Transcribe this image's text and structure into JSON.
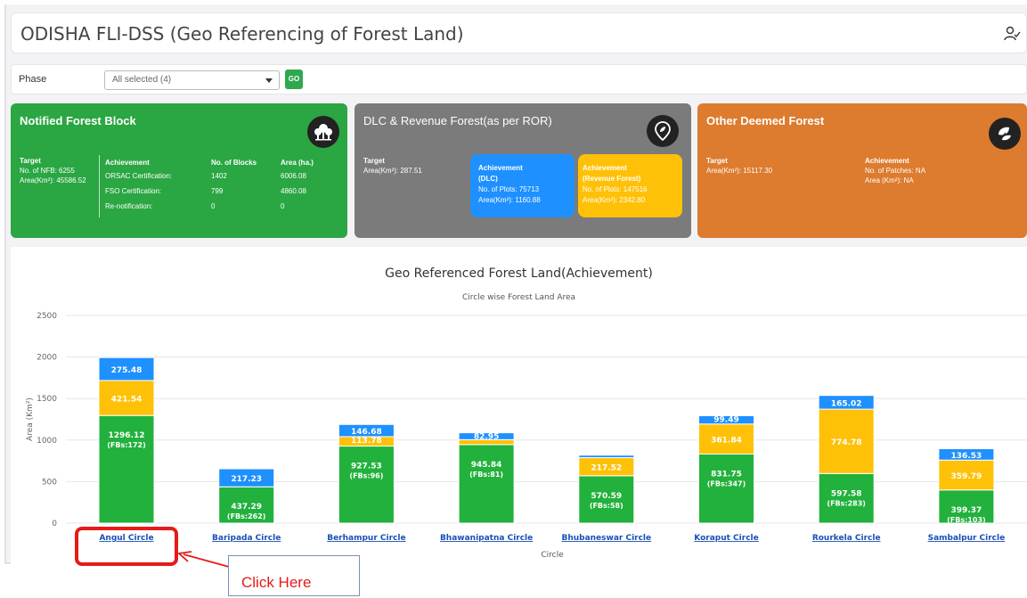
{
  "app": {
    "title": "ODISHA FLI-DSS (Geo Referencing of Forest Land)"
  },
  "filter": {
    "phase_label": "Phase",
    "phase_value": "All selected (4)",
    "go_label": "GO"
  },
  "cards": {
    "nfb": {
      "title": "Notified Forest Block",
      "target_heading": "Target",
      "target_line1": "No. of NFB: 6255",
      "target_line2": "Area(Km²): 45586.52",
      "achievement_heading": "Achievement",
      "blocks_heading": "No. of Blocks",
      "area_heading": "Area (ha.)",
      "rows": [
        {
          "label": "ORSAC Certification:",
          "blocks": "1402",
          "area": "6006.08"
        },
        {
          "label": "FSO Certification:",
          "blocks": "799",
          "area": "4860.08"
        },
        {
          "label": "Re-notification:",
          "blocks": "0",
          "area": "0"
        }
      ]
    },
    "dlc": {
      "title": "DLC & Revenue Forest(as per ROR)",
      "target_heading": "Target",
      "target_line": "Area(Km²): 287.51",
      "dlc_heading1": "Achievement",
      "dlc_heading2": "(DLC)",
      "dlc_plots": "No. of Plots: 75713",
      "dlc_area": "Area(Km²): 1160.88",
      "rev_heading1": "Achievement",
      "rev_heading2": "(Revenue Forest)",
      "rev_plots": "No. of Plots: 147516",
      "rev_area": "Area(Km²): 2342.80"
    },
    "deemed": {
      "title": "Other Deemed Forest",
      "target_heading": "Target",
      "target_line": "Area(Km²): 15117.30",
      "achievement_heading": "Achievement",
      "patches_line": "No. of Patches: NA",
      "area_line": "Area (Km²): NA"
    }
  },
  "chart_data": {
    "type": "bar",
    "stacked": true,
    "title": "Geo Referenced Forest Land(Achievement)",
    "subtitle": "Circle wise Forest Land Area",
    "xlabel": "Circle",
    "ylabel": "Area (Km²)",
    "ylim": [
      0,
      2500
    ],
    "yticks": [
      0,
      500,
      1000,
      1500,
      2000,
      2500
    ],
    "grid": true,
    "categories": [
      "Angul Circle",
      "Baripada Circle",
      "Berhampur Circle",
      "Bhawanipatna Circle",
      "Bhubaneswar Circle",
      "Koraput Circle",
      "Rourkela Circle",
      "Sambalpur Circle"
    ],
    "series": [
      {
        "color": "#22b13c",
        "values": [
          1296.12,
          437.29,
          927.53,
          945.84,
          570.59,
          831.75,
          597.58,
          399.37
        ],
        "labels": [
          "1296.12",
          "437.29",
          "927.53",
          "945.84",
          "570.59",
          "831.75",
          "597.58",
          "399.37"
        ],
        "sublabels": [
          "(FBs:172)",
          "(FBs:262)",
          "(FBs:96)",
          "(FBs:81)",
          "(FBs:58)",
          "(FBs:347)",
          "(FBs:283)",
          "(FBs:103)"
        ]
      },
      {
        "color": "#ffc107",
        "values": [
          421.54,
          0,
          113.78,
          59,
          217.52,
          361.84,
          774.78,
          359.79
        ],
        "labels": [
          "421.54",
          "",
          "113.78",
          "",
          "217.52",
          "361.84",
          "774.78",
          "359.79"
        ]
      },
      {
        "color": "#1e90ff",
        "values": [
          275.48,
          217.23,
          146.68,
          82.95,
          30,
          99.49,
          165.02,
          136.53
        ],
        "labels": [
          "275.48",
          "217.23",
          "146.68",
          "82.95",
          "",
          "99.49",
          "165.02",
          "136.53"
        ]
      }
    ]
  },
  "annotation": {
    "callout_text": "Click Here",
    "highlight_color": "#e61a1a"
  }
}
